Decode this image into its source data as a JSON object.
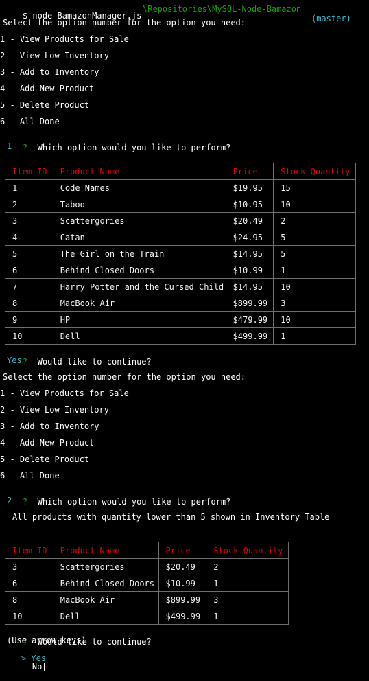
{
  "top_status": {
    "user": "\\Repositories\\MySQL-Node-Bamazon",
    "branch": "(master)"
  },
  "command": {
    "prompt_char": "$",
    "text": "node BamazonManager.js"
  },
  "menu1": {
    "header": "Select the option number for the option you need:",
    "options": [
      "1 - View Products for Sale",
      "2 - View Low Inventory",
      "3 - Add to Inventory",
      "4 - Add New Product",
      "5 - Delete Product",
      "6 - All Done"
    ]
  },
  "q1": {
    "mark": "?",
    "question": "Which option would you like to perform?",
    "answer": "1"
  },
  "table1": {
    "headers": [
      "Item ID",
      "Product Name",
      "Price",
      "Stock Quantity"
    ],
    "rows": [
      [
        "1",
        "Code Names",
        "$19.95",
        "15"
      ],
      [
        "2",
        "Taboo",
        "$10.95",
        "10"
      ],
      [
        "3",
        "Scattergories",
        "$20.49",
        "2"
      ],
      [
        "4",
        "Catan",
        "$24.95",
        "5"
      ],
      [
        "5",
        "The Girl on the Train",
        "$14.95",
        "5"
      ],
      [
        "6",
        "Behind Closed Doors",
        "$10.99",
        "1"
      ],
      [
        "7",
        "Harry Potter and the Cursed Child",
        "$14.95",
        "10"
      ],
      [
        "8",
        "MacBook Air",
        "$899.99",
        "3"
      ],
      [
        "9",
        "HP",
        "$479.99",
        "10"
      ],
      [
        "10",
        "Dell",
        "$499.99",
        "1"
      ]
    ]
  },
  "q2": {
    "mark": "?",
    "question": "Would like to continue?",
    "answer": "Yes"
  },
  "menu2": {
    "header": "Select the option number for the option you need:",
    "options": [
      "1 - View Products for Sale",
      "2 - View Low Inventory",
      "3 - Add to Inventory",
      "4 - Add New Product",
      "5 - Delete Product",
      "6 - All Done"
    ]
  },
  "q3": {
    "mark": "?",
    "question": "Which option would you like to perform?",
    "answer": "2"
  },
  "low_msg": "All products with quantity lower than 5 shown in Inventory Table",
  "table2": {
    "headers": [
      "Item ID",
      "Product Name",
      "Price",
      "Stock Quantity"
    ],
    "rows": [
      [
        "3",
        "Scattergories",
        "$20.49",
        "2"
      ],
      [
        "6",
        "Behind Closed Doors",
        "$10.99",
        "1"
      ],
      [
        "8",
        "MacBook Air",
        "$899.99",
        "3"
      ],
      [
        "10",
        "Dell",
        "$499.99",
        "1"
      ]
    ]
  },
  "q4": {
    "mark": "?",
    "question": "Would like to continue?",
    "hint": "(Use arrow keys)",
    "pointer": ">",
    "choices": [
      "Yes",
      "No"
    ]
  },
  "colors": {
    "prompt_mark": "#13a10e",
    "answer": "#3ab6c8",
    "table_header": "#e0000b",
    "border": "#6e6e6e"
  }
}
